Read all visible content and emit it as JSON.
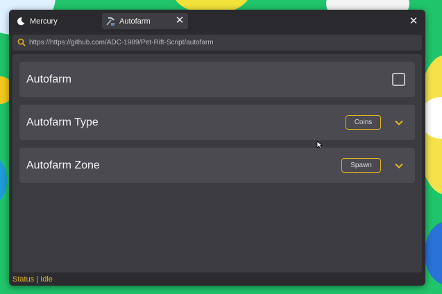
{
  "window": {
    "tabs": [
      {
        "label": "Mercury",
        "icon": "moon-icon",
        "active": false
      },
      {
        "label": "Autofarm",
        "icon": "pickaxe-icon",
        "active": true
      }
    ],
    "close_glyph": "✕"
  },
  "address": {
    "url": "https://https://github.com/ADC-1989/Pet-Rift-Script/autofarm",
    "icon": "search-icon"
  },
  "rows": [
    {
      "label": "Autofarm",
      "control": "checkbox",
      "checked": false
    },
    {
      "label": "Autofarm Type",
      "control": "dropdown",
      "value": "Coins"
    },
    {
      "label": "Autofarm Zone",
      "control": "dropdown",
      "value": "Spawn"
    }
  ],
  "status": {
    "text": "Status | Idle"
  },
  "colors": {
    "accent": "#e8b51d",
    "window_bg": "#2c2c30",
    "row_bg": "#4a4a50"
  }
}
